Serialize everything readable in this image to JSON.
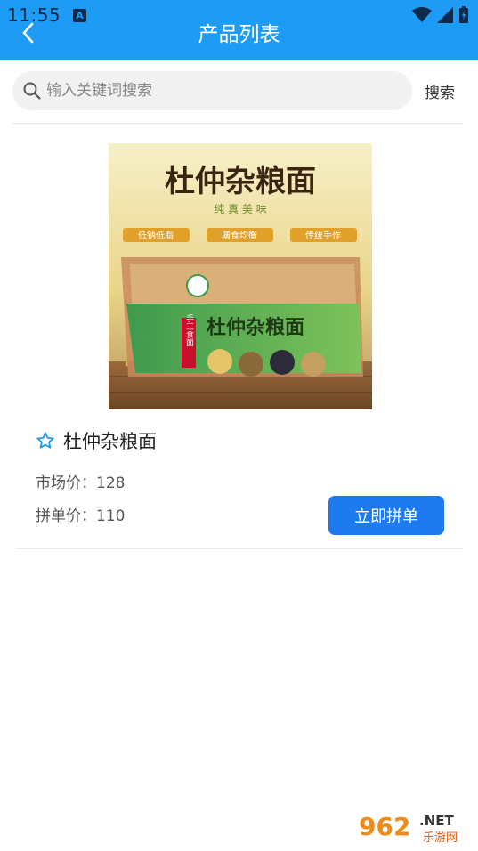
{
  "status_bar": {
    "time": "11:55",
    "notif_badge": "A"
  },
  "header": {
    "title": "产品列表"
  },
  "search": {
    "placeholder": "输入关键词搜索",
    "value": "",
    "button_label": "搜索"
  },
  "product": {
    "name": "杜仲杂粮面",
    "market_price_label": "市场价：",
    "market_price": "128",
    "group_price_label": "拼单价：",
    "group_price": "110",
    "buy_label": "立即拼单",
    "image": {
      "banner_title": "杜仲杂粮面",
      "banner_subtitle": "纯 真 美 味",
      "tags": [
        "低钠低脂",
        "膳食均衡",
        "传统手作"
      ],
      "package_title": "杜仲杂粮面",
      "package_side": "手工食面"
    }
  },
  "watermark": {
    "big": "962",
    "net": ".NET",
    "small": "乐游网"
  },
  "colors": {
    "appbar": "#1e9bf5",
    "button": "#1e7bef",
    "star": "#1e9bf5"
  }
}
